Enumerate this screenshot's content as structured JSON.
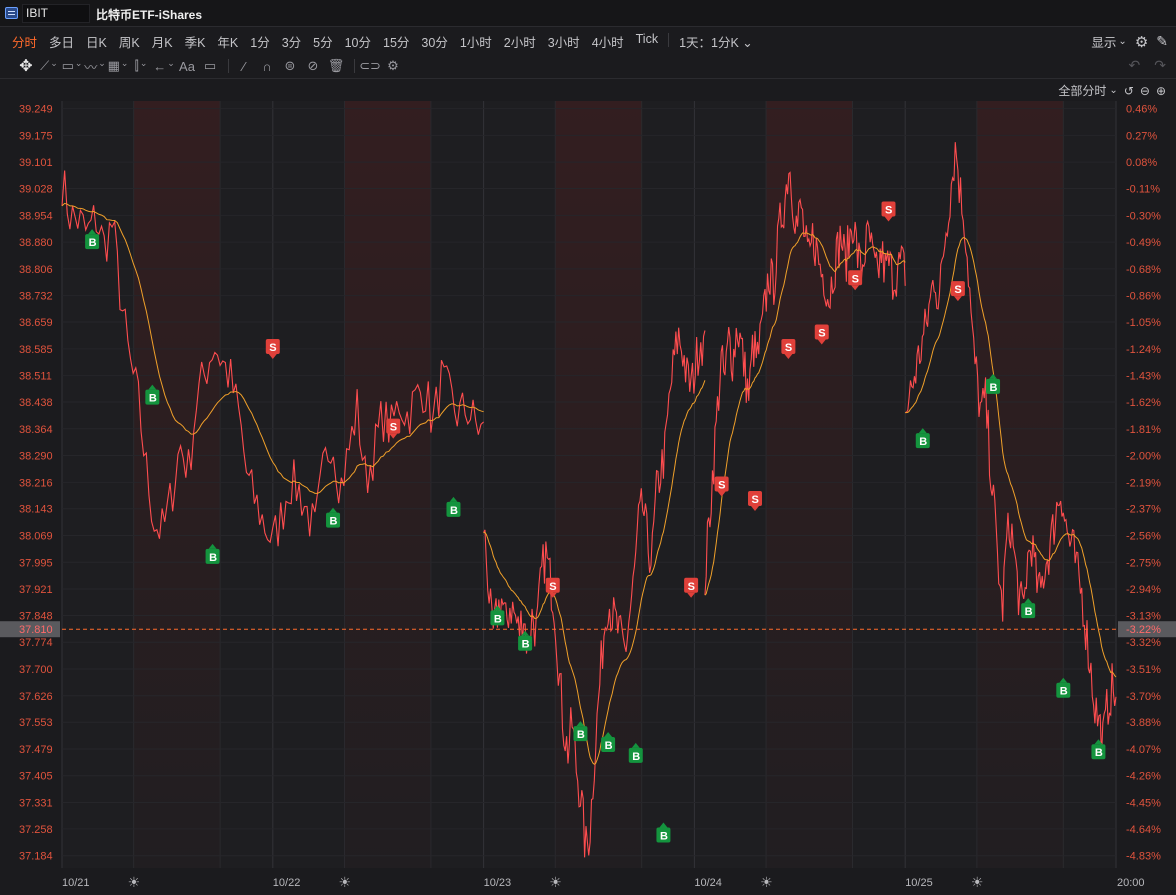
{
  "header": {
    "symbol": "IBIT",
    "title": "比特币ETF-iShares"
  },
  "periods": [
    "分时",
    "多日",
    "日K",
    "周K",
    "月K",
    "季K",
    "年K",
    "1分",
    "3分",
    "5分",
    "10分",
    "15分",
    "30分",
    "1小时",
    "2小时",
    "3小时",
    "4小时",
    "Tick"
  ],
  "active_period": "分时",
  "day_select": "1天：1分K",
  "display_label": "显示",
  "all_period_label": "全部分时",
  "text_tool": "Aa",
  "colors": {
    "up": "#ff4d4f",
    "down": "#00b35c",
    "accent": "#ff6a2b",
    "avg": "#f0a02a"
  },
  "chart_data": {
    "type": "line",
    "title": "",
    "price_ticks": [
      "39.249",
      "39.175",
      "39.101",
      "39.028",
      "38.954",
      "38.880",
      "38.806",
      "38.732",
      "38.659",
      "38.585",
      "38.511",
      "38.438",
      "38.364",
      "38.290",
      "38.216",
      "38.143",
      "38.069",
      "37.995",
      "37.921",
      "37.848",
      "37.774",
      "37.700",
      "37.626",
      "37.553",
      "37.479",
      "37.405",
      "37.331",
      "37.258",
      "37.184"
    ],
    "pct_ticks": [
      "0.46%",
      "0.27%",
      "0.08%",
      "-0.11%",
      "-0.30%",
      "-0.49%",
      "-0.68%",
      "-0.86%",
      "-1.05%",
      "-1.24%",
      "-1.43%",
      "-1.62%",
      "-1.81%",
      "-2.00%",
      "-2.19%",
      "-2.37%",
      "-2.56%",
      "-2.75%",
      "-2.94%",
      "-3.13%",
      "-3.32%",
      "-3.51%",
      "-3.70%",
      "-3.88%",
      "-4.07%",
      "-4.26%",
      "-4.45%",
      "-4.64%",
      "-4.83%"
    ],
    "ylim": [
      37.15,
      39.27
    ],
    "current": {
      "price": "37.810",
      "pct": "-3.22%"
    },
    "dates": [
      "10/21",
      "10/22",
      "10/23",
      "10/24",
      "10/25"
    ],
    "end_time": "20:00",
    "series": [
      {
        "name": "price",
        "x": [
          0,
          2,
          4,
          6,
          8,
          10,
          12,
          14,
          16,
          18,
          20,
          22,
          24,
          26,
          28,
          30,
          32,
          34,
          36,
          38,
          40,
          42,
          44,
          46,
          48,
          50,
          52,
          54,
          56,
          58,
          60,
          62,
          64,
          66,
          68,
          70,
          72,
          74,
          76,
          78,
          80,
          82,
          84,
          86,
          88,
          90,
          92,
          94,
          96,
          98,
          100
        ],
        "y": [
          39.05,
          38.95,
          38.94,
          38.9,
          38.95,
          38.87,
          38.93,
          38.72,
          38.55,
          38.45,
          38.25,
          38.1,
          38.08,
          38.18,
          38.32,
          38.25,
          38.45,
          38.52,
          38.6,
          38.55,
          38.5,
          38.4,
          38.22,
          38.16,
          38.1,
          38.05,
          38.12,
          38.22,
          38.2,
          38.14,
          38.08,
          38.25,
          38.35,
          38.2,
          38.3,
          38.42,
          38.22,
          38.3,
          38.4,
          38.36,
          38.44,
          38.4,
          38.45,
          38.48,
          38.38,
          38.5,
          38.45,
          38.4,
          38.42,
          38.38,
          38.35
        ]
      },
      {
        "name": "price_d3",
        "x": [
          0,
          2,
          4,
          6,
          8,
          10,
          12,
          14,
          16,
          18,
          20,
          22,
          24,
          26,
          28,
          30,
          32,
          34,
          36,
          38,
          40,
          42,
          44,
          46,
          48,
          50,
          52,
          54,
          56,
          58,
          60,
          62,
          64,
          66,
          68,
          70,
          72,
          74,
          76,
          78,
          80,
          82,
          84,
          86,
          88,
          90,
          92,
          94,
          96,
          98,
          100
        ],
        "y": [
          38.1,
          37.95,
          37.78,
          37.85,
          37.9,
          37.82,
          37.88,
          37.85,
          37.8,
          37.86,
          37.75,
          37.85,
          37.8,
          37.95,
          38.02,
          37.95,
          37.88,
          37.7,
          37.55,
          37.47,
          37.55,
          37.42,
          37.35,
          37.2,
          37.25,
          37.45,
          37.62,
          37.78,
          37.9,
          37.85,
          37.82,
          37.78,
          37.75,
          37.85,
          37.95,
          38.1,
          38.15,
          38.05,
          38.0,
          38.18,
          38.25,
          38.3,
          38.45,
          38.55,
          38.62,
          38.58,
          38.5,
          38.48,
          38.55,
          38.62,
          38.58
        ]
      }
    ],
    "markers": [
      {
        "t": "B",
        "d": 0,
        "p": 38.88
      },
      {
        "t": "B",
        "d": 0,
        "p": 38.45
      },
      {
        "t": "B",
        "d": 0,
        "p": 38.01
      },
      {
        "t": "S",
        "d": 0,
        "p": 38.59
      },
      {
        "t": "B",
        "d": 0,
        "p": 38.11
      },
      {
        "t": "S",
        "d": 0,
        "p": 38.37
      },
      {
        "t": "B",
        "d": 0,
        "p": 38.14
      },
      {
        "t": "B",
        "d": 1,
        "p": 37.84
      },
      {
        "t": "B",
        "d": 1,
        "p": 37.77
      },
      {
        "t": "S",
        "d": 1,
        "p": 37.93
      },
      {
        "t": "B",
        "d": 1,
        "p": 37.52
      },
      {
        "t": "B",
        "d": 1,
        "p": 37.49
      },
      {
        "t": "B",
        "d": 1,
        "p": 37.46
      },
      {
        "t": "B",
        "d": 1,
        "p": 37.24
      },
      {
        "t": "S",
        "d": 1,
        "p": 37.93
      },
      {
        "t": "S",
        "d": 2,
        "p": 38.21
      },
      {
        "t": "S",
        "d": 2,
        "p": 38.17
      },
      {
        "t": "S",
        "d": 2,
        "p": 38.59
      },
      {
        "t": "S",
        "d": 2,
        "p": 38.63
      },
      {
        "t": "S",
        "d": 2,
        "p": 38.78
      },
      {
        "t": "S",
        "d": 2,
        "p": 38.97
      },
      {
        "t": "B",
        "d": 3,
        "p": 38.33
      },
      {
        "t": "S",
        "d": 3,
        "p": 38.75
      },
      {
        "t": "B",
        "d": 3,
        "p": 38.48
      },
      {
        "t": "B",
        "d": 3,
        "p": 37.86
      },
      {
        "t": "B",
        "d": 3,
        "p": 37.64
      },
      {
        "t": "B",
        "d": 3,
        "p": 37.47
      }
    ]
  }
}
